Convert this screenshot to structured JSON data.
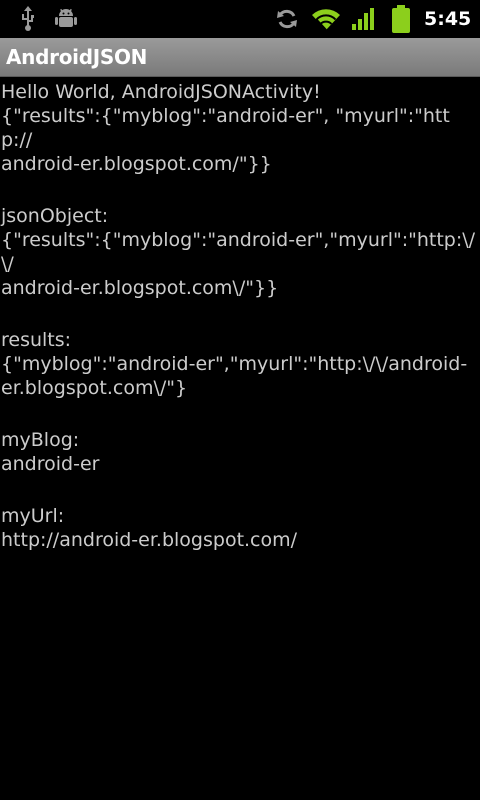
{
  "status_bar": {
    "time": "5:45",
    "icons": [
      "usb-icon",
      "debug-icon",
      "sync-icon",
      "wifi-icon",
      "signal-icon",
      "battery-icon"
    ],
    "accent_color": "#8ccf1c"
  },
  "app": {
    "title": "AndroidJSON"
  },
  "content": {
    "hello": "Hello World, AndroidJSONActivity!",
    "raw_json_line1": "{\"results\":{\"myblog\":\"android-er\", \"myurl\":\"http://",
    "raw_json_line2": "android-er.blogspot.com/\"}}",
    "json_object_label": "jsonObject:",
    "json_object_line1": "{\"results\":{\"myblog\":\"android-er\",\"myurl\":\"http:\\/\\/",
    "json_object_line2": "android-er.blogspot.com\\/\"}}",
    "results_label": "results:",
    "results_line1": "{\"myblog\":\"android-er\",\"myurl\":\"http:\\/\\/android-",
    "results_line2": "er.blogspot.com\\/\"}",
    "myblog_label": "myBlog:",
    "myblog_value": "android-er",
    "myurl_label": "myUrl:",
    "myurl_value": "http://android-er.blogspot.com/"
  }
}
